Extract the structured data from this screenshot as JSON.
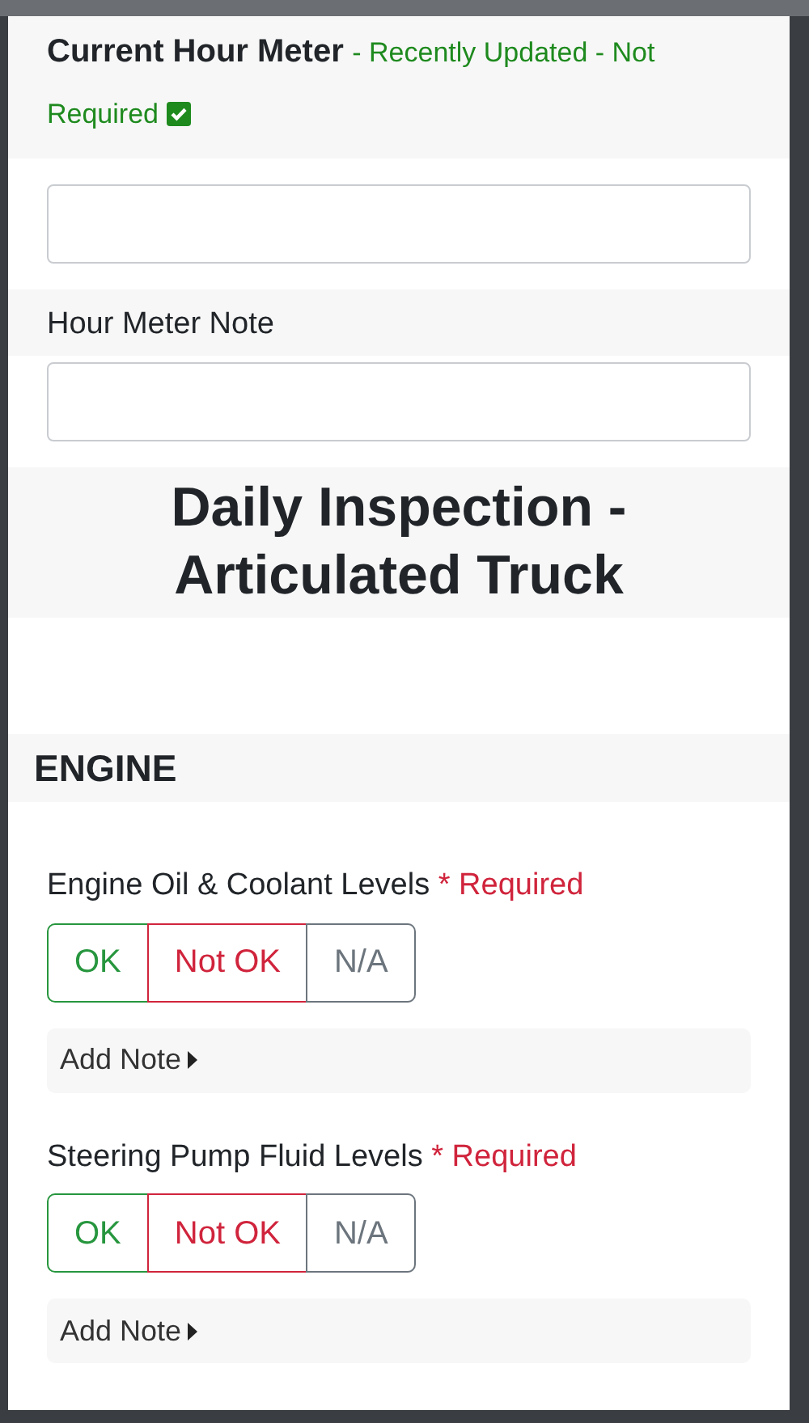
{
  "hour_meter": {
    "label": "Current Hour Meter",
    "status_lines": [
      "- Recently Updated - Not",
      "Required"
    ],
    "status_checked": true
  },
  "hour_meter_note": {
    "label": "Hour Meter Note"
  },
  "form_title": "Daily Inspection - Articulated Truck",
  "sections": [
    {
      "title": "ENGINE",
      "items": [
        {
          "label": "Engine Oil & Coolant Levels",
          "required": "* Required",
          "options": [
            {
              "label": "OK",
              "kind": "ok",
              "selected": false
            },
            {
              "label": "Not OK",
              "kind": "bad",
              "selected": false
            },
            {
              "label": "N/A",
              "kind": "na",
              "selected": false
            }
          ],
          "note_toggle": "Add Note"
        },
        {
          "label": "Steering Pump Fluid Levels",
          "required": "* Required",
          "options": [
            {
              "label": "OK",
              "kind": "ok",
              "selected": false
            },
            {
              "label": "Not OK",
              "kind": "bad",
              "selected": false
            },
            {
              "label": "N/A",
              "kind": "na",
              "selected": false
            }
          ],
          "note_toggle": "Add Note"
        }
      ]
    }
  ]
}
